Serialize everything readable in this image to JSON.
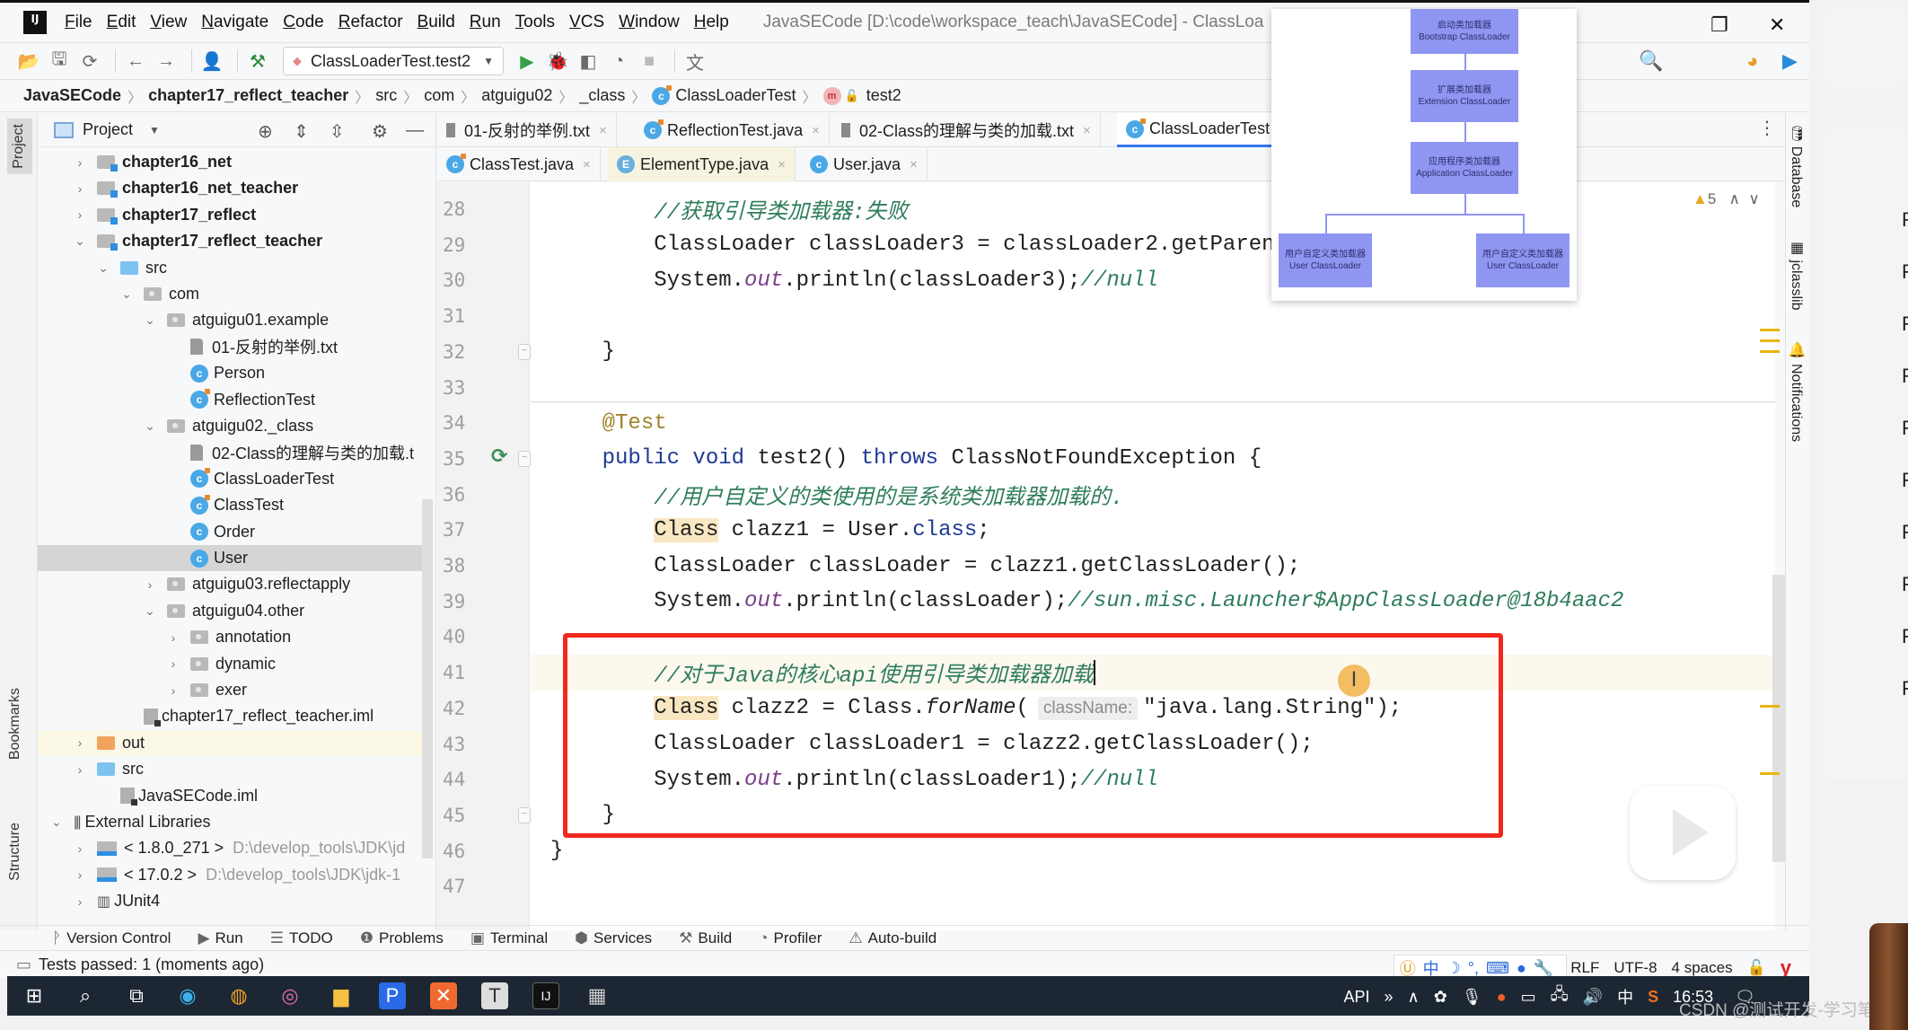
{
  "window": {
    "title": "JavaSECode [D:\\code\\workspace_teach\\JavaSECode] - ClassLoa",
    "app_logo": "IJ"
  },
  "menu": [
    "File",
    "Edit",
    "View",
    "Navigate",
    "Code",
    "Refactor",
    "Build",
    "Run",
    "Tools",
    "VCS",
    "Window",
    "Help"
  ],
  "toolbar": {
    "run_config": "ClassLoaderTest.test2"
  },
  "breadcrumb": [
    "JavaSECode",
    "chapter17_reflect_teacher",
    "src",
    "com",
    "atguigu02",
    "_class",
    "ClassLoaderTest",
    "test2"
  ],
  "left_strip": {
    "tabs": [
      "Project",
      "Bookmarks",
      "Structure"
    ]
  },
  "project": {
    "title": "Project",
    "tree": [
      {
        "label": "chapter16_net",
        "depth": 0,
        "kind": "module",
        "expand": "collapsed"
      },
      {
        "label": "chapter16_net_teacher",
        "depth": 0,
        "kind": "module",
        "expand": "collapsed"
      },
      {
        "label": "chapter17_reflect",
        "depth": 0,
        "kind": "module",
        "expand": "collapsed"
      },
      {
        "label": "chapter17_reflect_teacher",
        "depth": 0,
        "kind": "module",
        "expand": "expanded"
      },
      {
        "label": "src",
        "depth": 1,
        "kind": "src",
        "expand": "expanded"
      },
      {
        "label": "com",
        "depth": 2,
        "kind": "pkg",
        "expand": "expanded"
      },
      {
        "label": "atguigu01.example",
        "depth": 3,
        "kind": "pkg",
        "expand": "expanded"
      },
      {
        "label": "01-反射的举例.txt",
        "depth": 4,
        "kind": "txt",
        "expand": "none"
      },
      {
        "label": "Person",
        "depth": 4,
        "kind": "class",
        "expand": "none"
      },
      {
        "label": "ReflectionTest",
        "depth": 4,
        "kind": "class-run",
        "expand": "none"
      },
      {
        "label": "atguigu02._class",
        "depth": 3,
        "kind": "pkg",
        "expand": "expanded"
      },
      {
        "label": "02-Class的理解与类的加载.t",
        "depth": 4,
        "kind": "txt",
        "expand": "none"
      },
      {
        "label": "ClassLoaderTest",
        "depth": 4,
        "kind": "class-run",
        "expand": "none"
      },
      {
        "label": "ClassTest",
        "depth": 4,
        "kind": "class-run",
        "expand": "none"
      },
      {
        "label": "Order",
        "depth": 4,
        "kind": "class",
        "expand": "none"
      },
      {
        "label": "User",
        "depth": 4,
        "kind": "class",
        "expand": "none",
        "selected": true
      },
      {
        "label": "atguigu03.reflectapply",
        "depth": 3,
        "kind": "pkg",
        "expand": "collapsed"
      },
      {
        "label": "atguigu04.other",
        "depth": 3,
        "kind": "pkg",
        "expand": "expanded"
      },
      {
        "label": "annotation",
        "depth": 4,
        "kind": "pkg",
        "expand": "collapsed"
      },
      {
        "label": "dynamic",
        "depth": 4,
        "kind": "pkg",
        "expand": "collapsed"
      },
      {
        "label": "exer",
        "depth": 4,
        "kind": "pkg",
        "expand": "collapsed"
      },
      {
        "label": "chapter17_reflect_teacher.iml",
        "depth": 2,
        "kind": "iml",
        "expand": "none"
      },
      {
        "label": "out",
        "depth": 0,
        "kind": "out",
        "expand": "collapsed"
      },
      {
        "label": "src",
        "depth": 0,
        "kind": "src",
        "expand": "collapsed"
      },
      {
        "label": "JavaSECode.iml",
        "depth": 1,
        "kind": "iml",
        "expand": "none"
      },
      {
        "label": "External Libraries",
        "depth": -1,
        "kind": "lib",
        "expand": "expanded"
      },
      {
        "label": "< 1.8.0_271 >",
        "depth": 0,
        "kind": "jdk",
        "expand": "collapsed",
        "hint": "D:\\develop_tools\\JDK\\jd"
      },
      {
        "label": "< 17.0.2 >",
        "depth": 0,
        "kind": "jdk",
        "expand": "collapsed",
        "hint": "D:\\develop_tools\\JDK\\jdk-1"
      },
      {
        "label": "JUnit4",
        "depth": 0,
        "kind": "lib-item",
        "expand": "collapsed"
      }
    ]
  },
  "editor": {
    "tabs_row1": [
      {
        "label": "01-反射的举例.txt",
        "icon": "txt"
      },
      {
        "label": "ReflectionTest.java",
        "icon": "class-run"
      },
      {
        "label": "02-Class的理解与类的加载.txt",
        "icon": "txt"
      },
      {
        "label": "ClassLoaderTest",
        "icon": "class-run",
        "active": true
      }
    ],
    "tabs_row2": [
      {
        "label": "ClassTest.java",
        "icon": "class-run"
      },
      {
        "label": "ElementType.java",
        "icon": "enum"
      },
      {
        "label": "User.java",
        "icon": "class"
      }
    ],
    "warnings": "5",
    "lines": [
      {
        "n": "28",
        "tokens": [
          [
            "ind",
            "        "
          ],
          [
            "cm",
            "//获取引导类加载器:失败"
          ]
        ]
      },
      {
        "n": "29",
        "tokens": [
          [
            "ind",
            "        "
          ],
          [
            "t",
            "ClassLoader classLoader3 = classLoader2.getParen"
          ]
        ]
      },
      {
        "n": "30",
        "tokens": [
          [
            "ind",
            "        "
          ],
          [
            "t",
            "System."
          ],
          [
            "fld",
            "out"
          ],
          [
            "t",
            ".println(classLoader3);"
          ],
          [
            "cm",
            "//null"
          ]
        ]
      },
      {
        "n": "31",
        "tokens": []
      },
      {
        "n": "32",
        "tokens": [
          [
            "ind",
            "    "
          ],
          [
            "t",
            "}"
          ]
        ]
      },
      {
        "n": "33",
        "tokens": []
      },
      {
        "n": "34",
        "tokens": [
          [
            "ind",
            "    "
          ],
          [
            "an",
            "@Test"
          ]
        ]
      },
      {
        "n": "35",
        "tokens": [
          [
            "ind",
            "    "
          ],
          [
            "kw",
            "public void "
          ],
          [
            "t",
            "test2() "
          ],
          [
            "kw",
            "throws "
          ],
          [
            "t",
            "ClassNotFoundException {"
          ]
        ]
      },
      {
        "n": "36",
        "tokens": [
          [
            "ind",
            "        "
          ],
          [
            "cm",
            "//用户自定义的类使用的是系统类加载器加载的."
          ]
        ]
      },
      {
        "n": "37",
        "tokens": [
          [
            "ind",
            "        "
          ],
          [
            "hl",
            "Class"
          ],
          [
            "t",
            " clazz1 = User."
          ],
          [
            "kw",
            "class"
          ],
          [
            "t",
            ";"
          ]
        ]
      },
      {
        "n": "38",
        "tokens": [
          [
            "ind",
            "        "
          ],
          [
            "t",
            "ClassLoader classLoader = clazz1.getClassLoader();"
          ]
        ]
      },
      {
        "n": "39",
        "tokens": [
          [
            "ind",
            "        "
          ],
          [
            "t",
            "System."
          ],
          [
            "fld",
            "out"
          ],
          [
            "t",
            ".println(classLoader);"
          ],
          [
            "cm",
            "//sun.misc.Launcher$AppClassLoader@18b4aac2"
          ]
        ]
      },
      {
        "n": "40",
        "tokens": []
      },
      {
        "n": "41",
        "tokens": [
          [
            "ind",
            "        "
          ],
          [
            "cm",
            "//对于Java的核心api使用引导类加载器加载"
          ],
          [
            "caret",
            ""
          ]
        ]
      },
      {
        "n": "42",
        "tokens": [
          [
            "ind",
            "        "
          ],
          [
            "hl",
            "Class"
          ],
          [
            "t",
            " clazz2 = Class."
          ],
          [
            "fldi",
            "forName"
          ],
          [
            "t",
            "("
          ],
          [
            "hint",
            "className:"
          ],
          [
            "t",
            "\"java.lang.String\");"
          ]
        ]
      },
      {
        "n": "43",
        "tokens": [
          [
            "ind",
            "        "
          ],
          [
            "t",
            "ClassLoader classLoader1 = clazz2.getClassLoader();"
          ]
        ]
      },
      {
        "n": "44",
        "tokens": [
          [
            "ind",
            "        "
          ],
          [
            "t",
            "System."
          ],
          [
            "fld",
            "out"
          ],
          [
            "t",
            ".println(classLoader1);"
          ],
          [
            "cm",
            "//null"
          ]
        ]
      },
      {
        "n": "45",
        "tokens": [
          [
            "ind",
            "    "
          ],
          [
            "t",
            "}"
          ]
        ]
      },
      {
        "n": "46",
        "tokens": [
          [
            "t",
            "}"
          ]
        ]
      },
      {
        "n": "47",
        "tokens": []
      }
    ]
  },
  "diagram": {
    "nodes": [
      {
        "cn": "启动类加载器",
        "en": "Bootstrap ClassLoader"
      },
      {
        "cn": "扩展类加载器",
        "en": "Extension ClassLoader"
      },
      {
        "cn": "应用程序类加载器",
        "en": "Application ClassLoader"
      },
      {
        "cn": "用户自定义类加载器",
        "en": "User ClassLoader"
      },
      {
        "cn": "用户自定义类加载器",
        "en": "User ClassLoader"
      }
    ]
  },
  "right_strip": [
    "Database",
    "jclasslib",
    "Notifications"
  ],
  "tool_windows": [
    {
      "label": "Version Control",
      "icon": "vcs-icon"
    },
    {
      "label": "Run",
      "icon": "run-icon"
    },
    {
      "label": "TODO",
      "icon": "todo-icon"
    },
    {
      "label": "Problems",
      "icon": "problems-icon"
    },
    {
      "label": "Terminal",
      "icon": "terminal-icon"
    },
    {
      "label": "Services",
      "icon": "services-icon"
    },
    {
      "label": "Build",
      "icon": "build-icon"
    },
    {
      "label": "Profiler",
      "icon": "profiler-icon"
    },
    {
      "label": "Auto-build",
      "icon": "warning-icon"
    }
  ],
  "status": {
    "message": "Tests passed: 1 (moments ago)",
    "line_sep": "RLF",
    "encoding": "UTF-8",
    "indent": "4 spaces",
    "ime": [
      "中",
      "◐",
      "°,",
      "⌨",
      "👤",
      "🔧"
    ]
  },
  "taskbar": {
    "tray_text": "API",
    "lang": "中",
    "time": "16:53"
  },
  "watermark": "CSDN @测试开发-学习笔记",
  "side_panel_letters": [
    "F",
    "F",
    "F",
    "F",
    "F",
    "F",
    "F",
    "F",
    "F",
    "F"
  ]
}
